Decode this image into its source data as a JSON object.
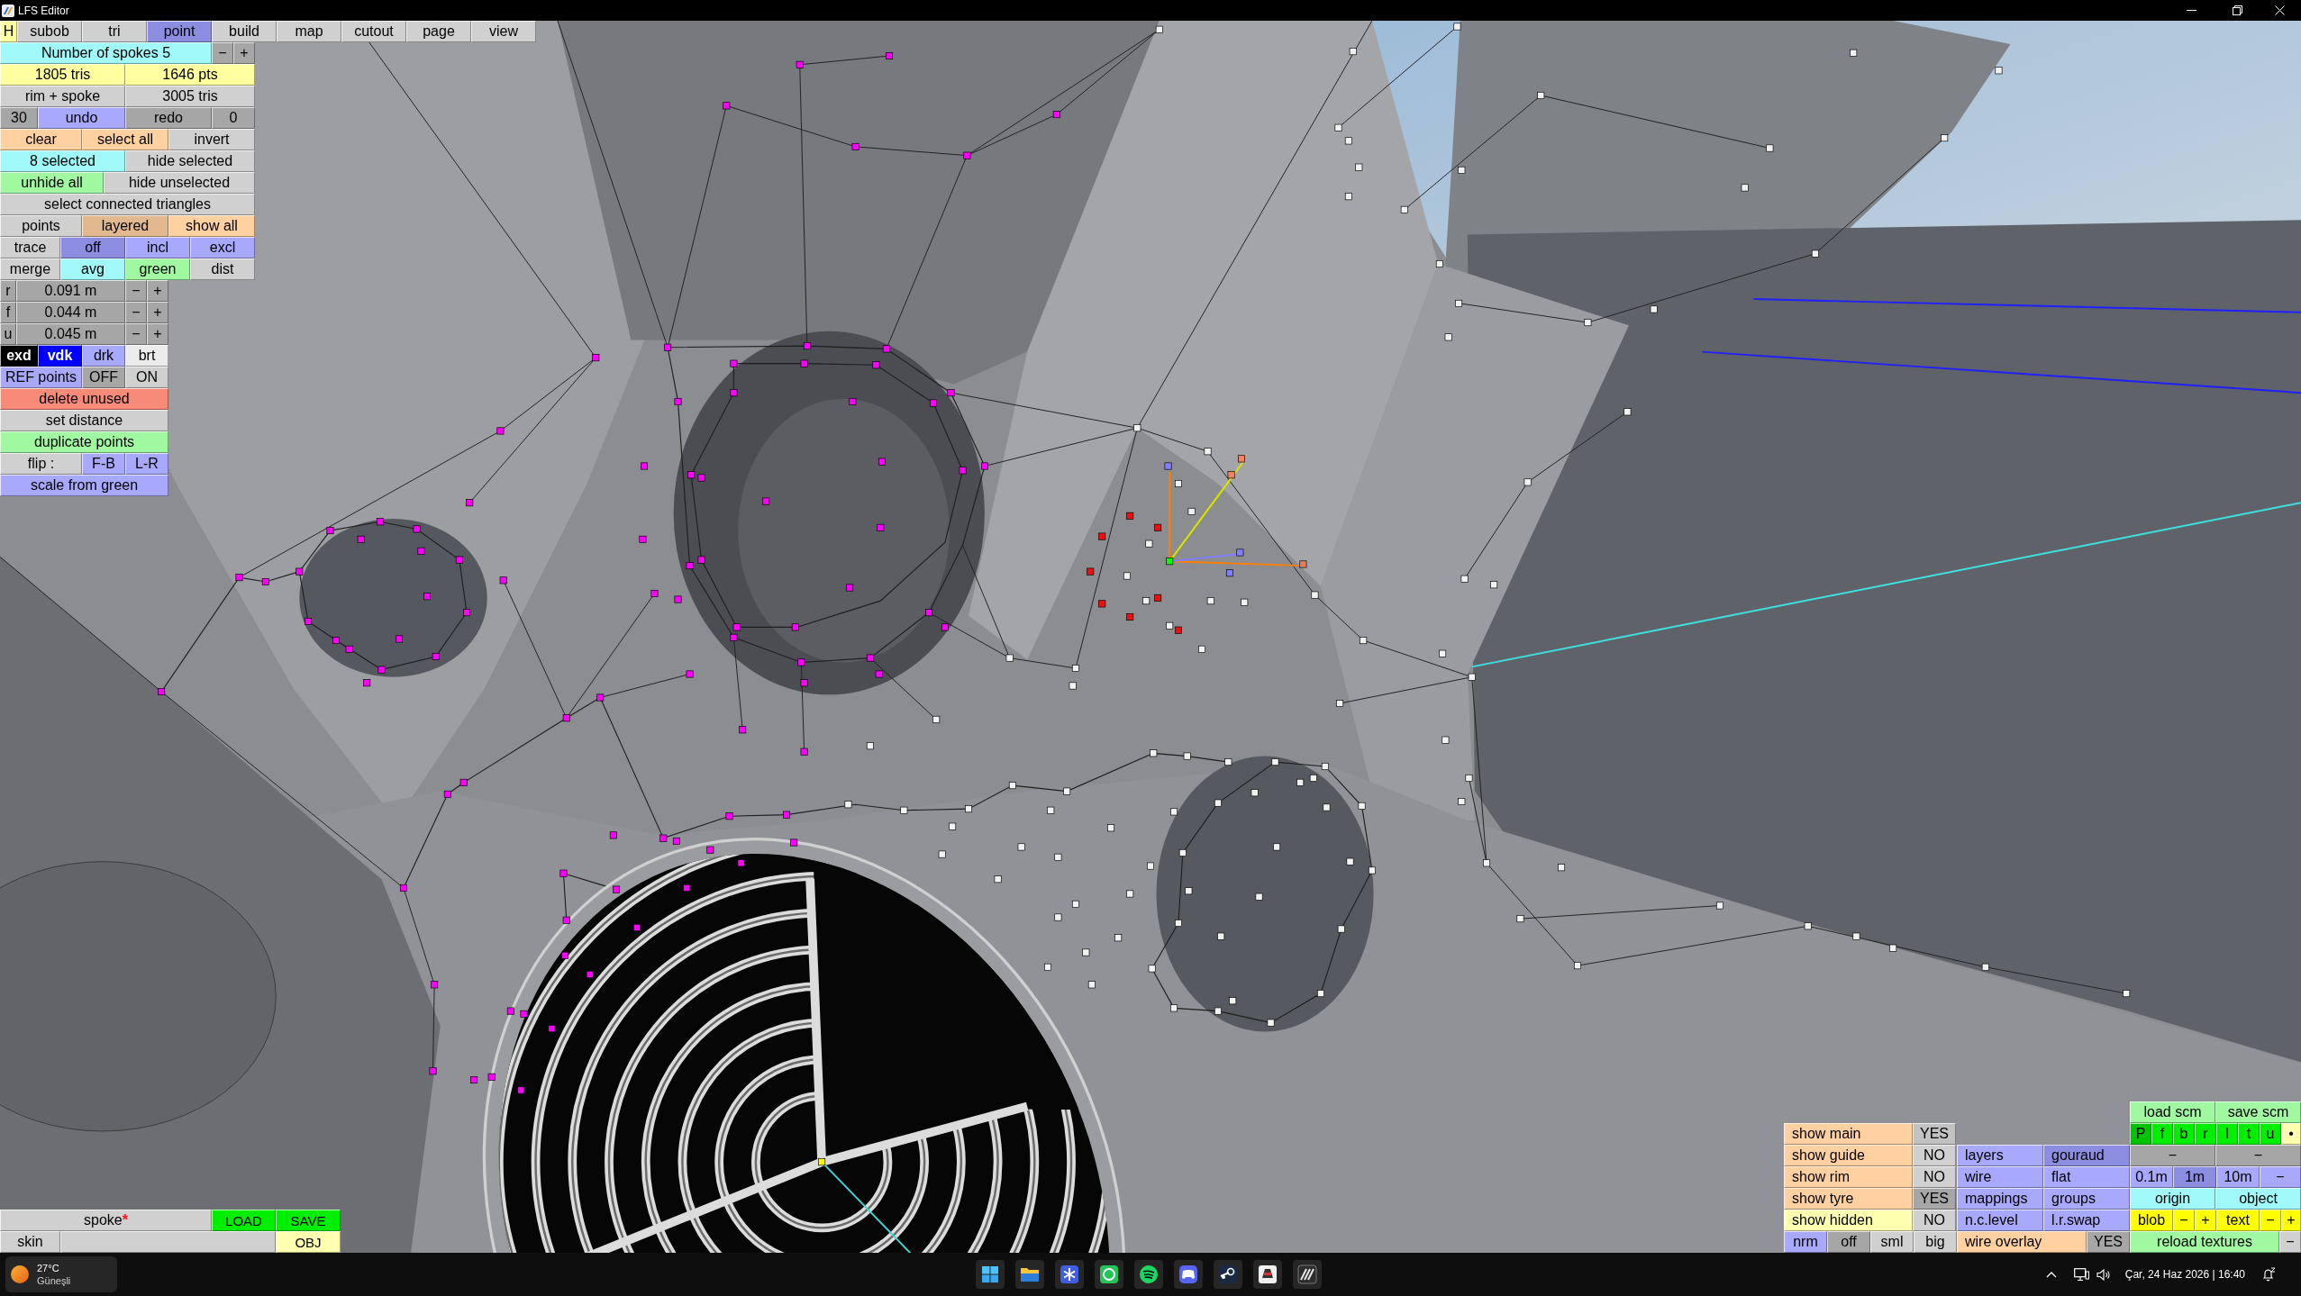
{
  "title_bar": {
    "title": "LFS Editor"
  },
  "menu": {
    "help": "H",
    "tabs": [
      {
        "label": "subob",
        "selected": false
      },
      {
        "label": "tri",
        "selected": false
      },
      {
        "label": "point",
        "selected": true
      },
      {
        "label": "build",
        "selected": false
      },
      {
        "label": "map",
        "selected": false
      },
      {
        "label": "cutout",
        "selected": false
      },
      {
        "label": "page",
        "selected": false
      },
      {
        "label": "view",
        "selected": false
      }
    ]
  },
  "edit_panel": {
    "rows": [
      [
        {
          "label": "Number of spokes 5",
          "kind": "info"
        },
        {
          "label": "−",
          "kind": "dim"
        },
        {
          "label": "+",
          "kind": "dim"
        }
      ],
      [
        {
          "label": "1805 tris",
          "kind": "count"
        },
        {
          "label": "1646 pts",
          "kind": "count"
        }
      ],
      [
        {
          "label": "rim + spoke",
          "kind": "plain"
        },
        {
          "label": "3005 tris",
          "kind": "plain"
        }
      ],
      [
        {
          "label": "30",
          "kind": "dim"
        },
        {
          "label": "undo",
          "kind": "toggle"
        },
        {
          "label": "redo",
          "kind": "dim"
        },
        {
          "label": "0",
          "kind": "dim"
        }
      ],
      [
        {
          "label": "clear",
          "kind": "action"
        },
        {
          "label": "select all",
          "kind": "action"
        },
        {
          "label": "invert",
          "kind": "plain"
        }
      ],
      [
        {
          "label": "8 selected",
          "kind": "info"
        },
        {
          "label": "hide selected",
          "kind": "plain"
        }
      ],
      [
        {
          "label": "unhide all",
          "kind": "ok"
        },
        {
          "label": "hide unselected",
          "kind": "plain"
        }
      ],
      [
        {
          "label": "select connected triangles",
          "kind": "plain"
        }
      ],
      [
        {
          "label": "points",
          "kind": "plain"
        },
        {
          "label": "layered",
          "kind": "pressed"
        },
        {
          "label": "show all",
          "kind": "action"
        }
      ],
      [
        {
          "label": "trace",
          "kind": "plain"
        },
        {
          "label": "off",
          "kind": "active"
        },
        {
          "label": "incl",
          "kind": "toggle"
        },
        {
          "label": "excl",
          "kind": "toggle"
        }
      ],
      [
        {
          "label": "merge",
          "kind": "plain"
        },
        {
          "label": "avg",
          "kind": "info"
        },
        {
          "label": "green",
          "kind": "ok"
        },
        {
          "label": "dist",
          "kind": "plain"
        }
      ],
      [
        {
          "label": "r",
          "kind": "dim"
        },
        {
          "label": "0.091 m",
          "kind": "dim"
        },
        {
          "label": "−",
          "kind": "dim"
        },
        {
          "label": "+",
          "kind": "dim"
        }
      ],
      [
        {
          "label": "f",
          "kind": "dim"
        },
        {
          "label": "0.044 m",
          "kind": "dim"
        },
        {
          "label": "−",
          "kind": "dim"
        },
        {
          "label": "+",
          "kind": "dim"
        }
      ],
      [
        {
          "label": "u",
          "kind": "dim"
        },
        {
          "label": "0.045 m",
          "kind": "dim"
        },
        {
          "label": "−",
          "kind": "dim"
        },
        {
          "label": "+",
          "kind": "dim"
        }
      ],
      [
        {
          "label": "exd",
          "kind": "dark"
        },
        {
          "label": "vdk",
          "kind": "strong"
        },
        {
          "label": "drk",
          "kind": "toggle"
        },
        {
          "label": "brt",
          "kind": "light"
        }
      ],
      [
        {
          "label": "REF points",
          "kind": "toggle"
        },
        {
          "label": "OFF",
          "kind": "dim"
        },
        {
          "label": "ON",
          "kind": "plain"
        }
      ],
      [
        {
          "label": "delete unused",
          "kind": "danger"
        }
      ],
      [
        {
          "label": "set distance",
          "kind": "plain"
        }
      ],
      [
        {
          "label": "duplicate points",
          "kind": "ok"
        }
      ],
      [
        {
          "label": "flip :",
          "kind": "plain"
        },
        {
          "label": "F-B",
          "kind": "toggle"
        },
        {
          "label": "L-R",
          "kind": "toggle"
        }
      ],
      [
        {
          "label": "scale from green",
          "kind": "toggle"
        }
      ]
    ]
  },
  "file_bar": {
    "name": "spoke",
    "unsaved_mark": "*",
    "load": "LOAD",
    "save": "SAVE",
    "skin_label": "skin",
    "export": "OBJ"
  },
  "view_panel": {
    "columns": [
      [
        [
          {
            "label": "show main",
            "kind": "action"
          },
          {
            "label": "YES",
            "kind": "mid"
          }
        ],
        [
          {
            "label": "show guide",
            "kind": "action"
          },
          {
            "label": "NO",
            "kind": "plain"
          }
        ],
        [
          {
            "label": "show rim",
            "kind": "action"
          },
          {
            "label": "NO",
            "kind": "plain"
          }
        ],
        [
          {
            "label": "show tyre",
            "kind": "action"
          },
          {
            "label": "YES",
            "kind": "dim"
          }
        ],
        [
          {
            "label": "show hidden",
            "kind": "note"
          },
          {
            "label": "NO",
            "kind": "plain"
          }
        ],
        [
          {
            "label": "nrm",
            "kind": "toggle"
          },
          {
            "label": "off",
            "kind": "dim"
          },
          {
            "label": "sml",
            "kind": "plain"
          },
          {
            "label": "big",
            "kind": "plain"
          }
        ]
      ],
      [
        [
          {
            "label": "layers",
            "kind": "toggle"
          },
          {
            "label": "gouraud",
            "kind": "active"
          }
        ],
        [
          {
            "label": "wire",
            "kind": "toggle"
          },
          {
            "label": "flat",
            "kind": "toggle"
          }
        ],
        [
          {
            "label": "mappings",
            "kind": "toggle"
          },
          {
            "label": "groups",
            "kind": "toggle"
          }
        ],
        [
          {
            "label": "n.c.level",
            "kind": "toggle"
          },
          {
            "label": "l.r.swap",
            "kind": "toggle"
          }
        ],
        [
          {
            "label": "wire overlay",
            "kind": "action"
          },
          {
            "label": "YES",
            "kind": "dim"
          }
        ]
      ],
      [
        [
          {
            "label": "load scm",
            "kind": "ok"
          },
          {
            "label": "save scm",
            "kind": "ok"
          }
        ],
        [
          {
            "label": "P",
            "kind": "go_on"
          },
          {
            "label": "f",
            "kind": "go"
          },
          {
            "label": "b",
            "kind": "go"
          },
          {
            "label": "r",
            "kind": "go"
          },
          {
            "label": "l",
            "kind": "go"
          },
          {
            "label": "t",
            "kind": "go"
          },
          {
            "label": "u",
            "kind": "go"
          },
          {
            "label": "•",
            "kind": "note"
          }
        ],
        [
          {
            "label": "−",
            "kind": "dim"
          },
          {
            "label": "−",
            "kind": "dim"
          }
        ],
        [
          {
            "label": "0.1m",
            "kind": "toggle"
          },
          {
            "label": "1m",
            "kind": "active"
          },
          {
            "label": "10m",
            "kind": "toggle"
          },
          {
            "label": "−",
            "kind": "toggle"
          }
        ],
        [
          {
            "label": "origin",
            "kind": "info"
          },
          {
            "label": "object",
            "kind": "info"
          }
        ],
        [
          {
            "label": "blob",
            "kind": "warn"
          },
          {
            "label": "−",
            "kind": "warn"
          },
          {
            "label": "+",
            "kind": "warn"
          },
          {
            "label": "text",
            "kind": "warn"
          },
          {
            "label": "−",
            "kind": "warn"
          },
          {
            "label": "+",
            "kind": "warn"
          }
        ],
        [
          {
            "label": "reload textures",
            "kind": "ok"
          },
          {
            "label": "−",
            "kind": "plain"
          }
        ]
      ]
    ]
  },
  "taskbar": {
    "weather": {
      "temperature": "27°C",
      "condition": "Güneşli"
    },
    "clock": "Çar, 24 Haz 2026 | 16:40"
  }
}
